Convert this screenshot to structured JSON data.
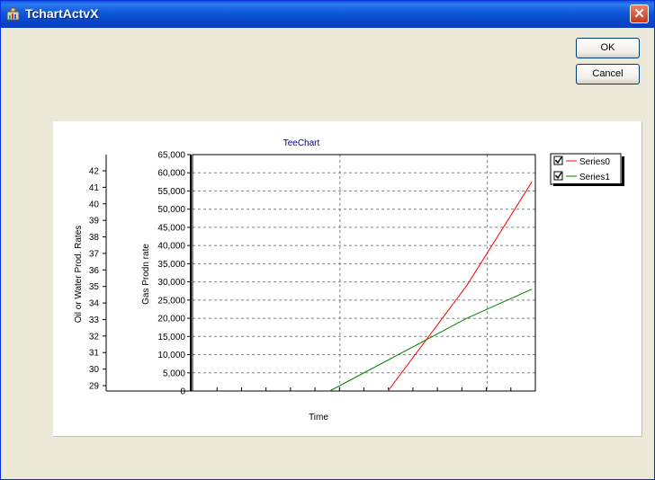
{
  "window": {
    "title": "TchartActvX"
  },
  "buttons": {
    "ok": "OK",
    "cancel": "Cancel"
  },
  "colors": {
    "series0": "#FF0000",
    "series1": "#008000",
    "title": "#000080"
  },
  "chart_data": {
    "type": "line",
    "title": "TeeChart",
    "xlabel": "Time",
    "ylabel_left": "Oil or Water Prod. Rates",
    "ylabel_right": "Gas Prodn rate",
    "left_axis_ticks": [
      "29",
      "30",
      "31",
      "32",
      "33",
      "34",
      "35",
      "36",
      "37",
      "38",
      "39",
      "40",
      "41",
      "42"
    ],
    "gas_axis_ticks": [
      "0",
      "5,000",
      "10,000",
      "15,000",
      "20,000",
      "25,000",
      "30,000",
      "35,000",
      "40,000",
      "45,000",
      "50,000",
      "55,000",
      "60,000",
      "65,000"
    ],
    "gas_ylim": [
      0,
      65000
    ],
    "x_range": [
      0,
      1
    ],
    "grid": true,
    "legend_placement": "top-right",
    "series": [
      {
        "name": "Series0",
        "x": [
          0.57,
          0.8,
          0.99
        ],
        "values": [
          0,
          29000,
          57500
        ]
      },
      {
        "name": "Series1",
        "x": [
          0.4,
          0.8,
          0.99
        ],
        "values": [
          0,
          20000,
          28000
        ]
      }
    ]
  }
}
